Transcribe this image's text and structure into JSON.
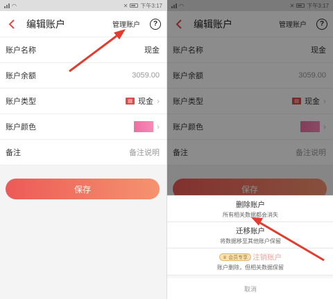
{
  "status_bar": {
    "time": "下午3:17"
  },
  "left": {
    "nav": {
      "title": "编辑账户",
      "manage": "管理账户",
      "help": "?"
    },
    "rows": [
      {
        "label": "账户名称",
        "value": "现金"
      },
      {
        "label": "账户余额",
        "value": "3059.00"
      },
      {
        "label": "账户类型",
        "value": "现金"
      },
      {
        "label": "账户颜色",
        "value": ""
      },
      {
        "label": "备注",
        "value": "备注说明"
      }
    ],
    "save_label": "保存"
  },
  "right": {
    "nav": {
      "title": "编辑账户",
      "manage": "管理账户",
      "help": "?"
    },
    "rows": [
      {
        "label": "账户名称",
        "value": "现金"
      },
      {
        "label": "账户余额",
        "value": "3059.00"
      },
      {
        "label": "账户类型",
        "value": "现金"
      },
      {
        "label": "账户颜色",
        "value": ""
      },
      {
        "label": "备注",
        "value": "备注说明"
      }
    ],
    "save_label": "保存",
    "sheet": {
      "delete": {
        "title": "删除账户",
        "sub": "所有相关数据都会消失"
      },
      "migrate": {
        "title": "迁移账户",
        "sub": "将数据移至其他账户保留"
      },
      "cancel_account": {
        "badge": "会员专享",
        "title": "注销账户",
        "sub": "账户删除，但相关数据保留"
      },
      "cancel": "取消"
    }
  },
  "colors": {
    "accent": "#ec5a57",
    "arrow": "#e33b2e",
    "account_color": "#ee6fa3"
  },
  "icons": [
    "back-chevron-icon",
    "help-circle-icon",
    "cash-icon",
    "chevron-right-icon",
    "crown-icon",
    "wifi-icon",
    "signal-icon",
    "battery-icon"
  ]
}
